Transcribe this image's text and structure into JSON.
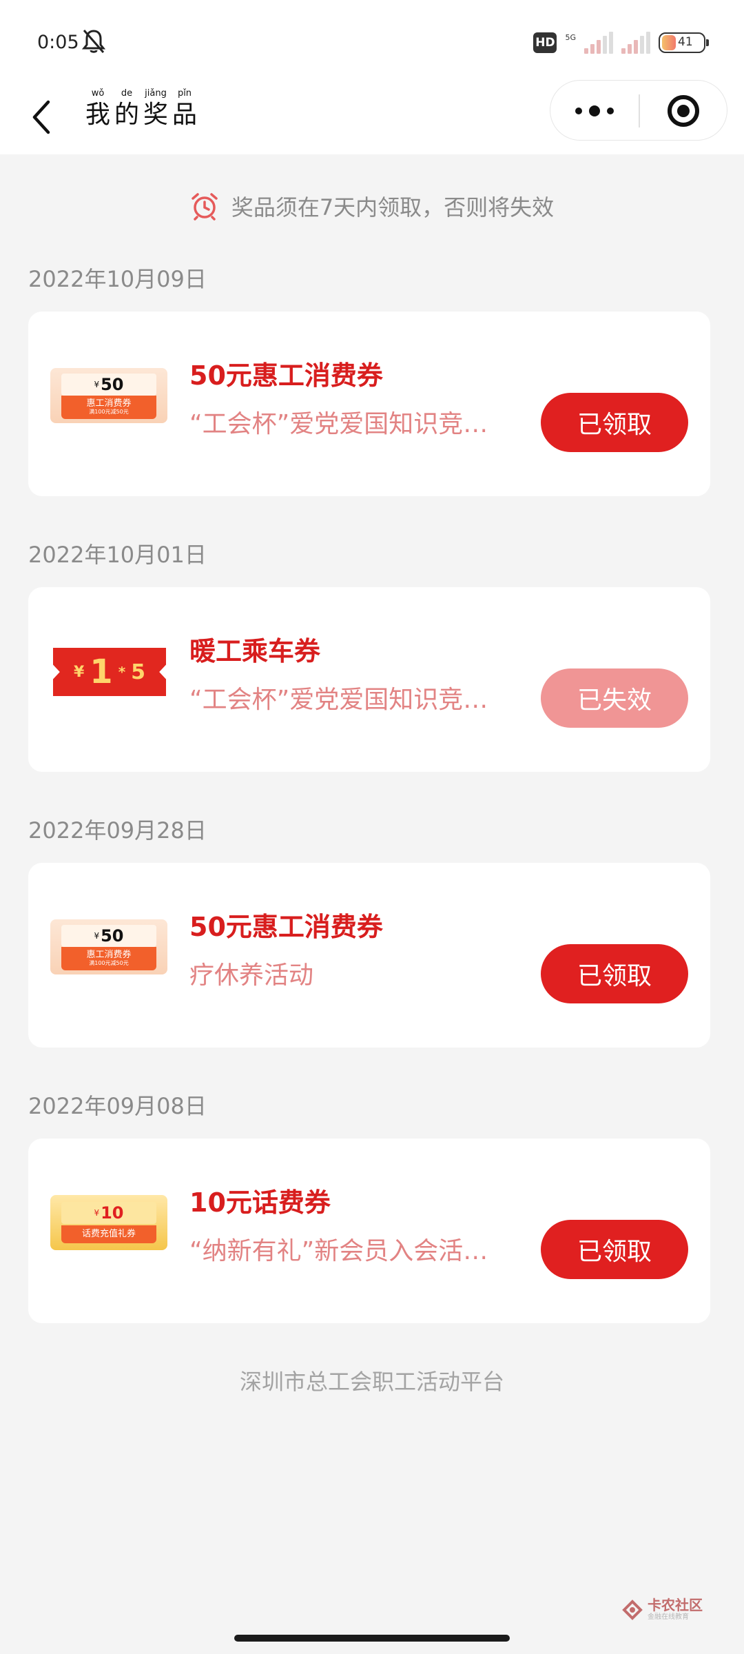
{
  "status_bar": {
    "time": "0:05",
    "hd": "HD",
    "network": "5G",
    "battery": "41"
  },
  "nav": {
    "title": [
      {
        "pinyin": "wǒ",
        "char": "我"
      },
      {
        "pinyin": "de",
        "char": "的"
      },
      {
        "pinyin": "jiǎng",
        "char": "奖"
      },
      {
        "pinyin": "pǐn",
        "char": "品"
      }
    ]
  },
  "notice": {
    "text": "奖品须在7天内领取，否则将失效",
    "icon": "alarm-clock-icon",
    "icon_color": "#e55a5a"
  },
  "colors": {
    "accent": "#e02020",
    "prize_name": "#d81e1e",
    "prize_source": "#e28383",
    "expired_button": "#f09595"
  },
  "prizes": [
    {
      "date": "2022年10月09日",
      "name": "50元惠工消费券",
      "source": "“工会杯”爱党爱国知识竞…",
      "status": "已领取",
      "thumb": {
        "type": "orange-coupon",
        "yen": "¥",
        "value": "50",
        "sub": "惠工消费券",
        "sub2": "满100元减50元"
      }
    },
    {
      "date": "2022年10月01日",
      "name": "暖工乘车券",
      "source": "“工会杯”爱党爱国知识竞…",
      "status": "已失效",
      "thumb": {
        "type": "red-ticket",
        "yen": "¥",
        "value": "1",
        "sep": "*",
        "count": "5"
      }
    },
    {
      "date": "2022年09月28日",
      "name": "50元惠工消费券",
      "source": "疗休养活动",
      "status": "已领取",
      "thumb": {
        "type": "orange-coupon",
        "yen": "¥",
        "value": "50",
        "sub": "惠工消费券",
        "sub2": "满100元减50元"
      }
    },
    {
      "date": "2022年09月08日",
      "name": "10元话费券",
      "source": "“纳新有礼”新会员入会活…",
      "status": "已领取",
      "thumb": {
        "type": "yellow-coupon",
        "yen": "¥",
        "value": "10",
        "sub": "话费充值礼券"
      }
    }
  ],
  "footer": {
    "text": "深圳市总工会职工活动平台"
  },
  "watermark": {
    "main": "卡农社区",
    "sub": "金融在线教育"
  }
}
